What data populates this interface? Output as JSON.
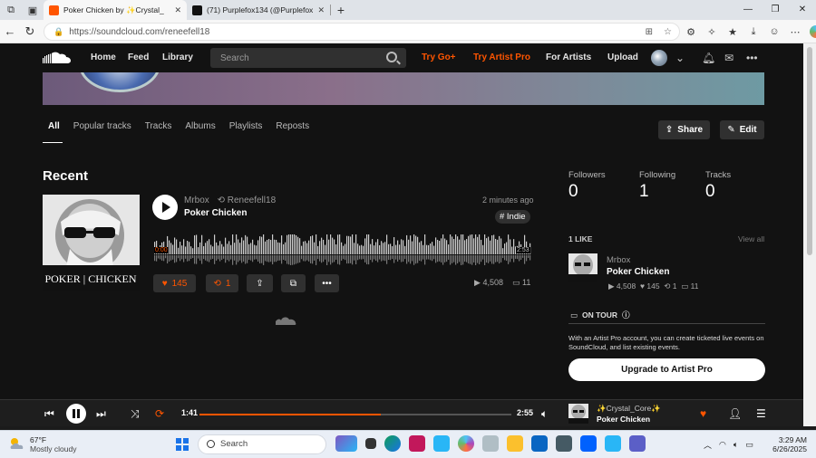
{
  "browser": {
    "tabs": [
      {
        "title": "Poker Chicken by ✨Crystal_",
        "active": true,
        "favicon_color": "#ff5500"
      },
      {
        "title": "(71) Purplefox134 (@Purplefox13",
        "active": false,
        "favicon_color": "#111111"
      }
    ],
    "url": "https://soundcloud.com/reneefell18"
  },
  "header": {
    "nav": [
      "Home",
      "Feed",
      "Library"
    ],
    "search_placeholder": "Search",
    "try_go": "Try Go+",
    "try_artist_pro": "Try Artist Pro",
    "for_artists": "For Artists",
    "upload": "Upload"
  },
  "profile_tabs": [
    "All",
    "Popular tracks",
    "Tracks",
    "Albums",
    "Playlists",
    "Reposts"
  ],
  "actions": {
    "share": "Share",
    "edit": "Edit"
  },
  "recent": {
    "title": "Recent",
    "track": {
      "user": "Mrbox",
      "reposter": "Reneefell18",
      "name": "Poker Chicken",
      "time": "2 minutes ago",
      "tag": "# Indie",
      "elapsed": "0:00",
      "duration": "2:53",
      "likes": "145",
      "reposts": "1",
      "plays": "4,508",
      "comments": "11",
      "artwork_text": "POKER | CHICKEN"
    }
  },
  "sidebar": {
    "stats": [
      {
        "label": "Followers",
        "value": "0"
      },
      {
        "label": "Following",
        "value": "1"
      },
      {
        "label": "Tracks",
        "value": "0"
      }
    ],
    "likes_header": "1 LIKE",
    "view_all": "View all",
    "like": {
      "user": "Mrbox",
      "name": "Poker Chicken",
      "plays": "4,508",
      "likes": "145",
      "reposts": "1",
      "comments": "11"
    },
    "tour_header": "ON TOUR",
    "tour_text": "With an Artist Pro account, you can create ticketed live events on SoundCloud, and list existing events.",
    "upgrade": "Upgrade to Artist Pro"
  },
  "player": {
    "elapsed": "1:41",
    "duration": "2:55",
    "progress": 0.58,
    "user": "✨Crystal_Core✨",
    "title": "Poker Chicken"
  },
  "taskbar": {
    "temp": "67°F",
    "weather": "Mostly cloudy",
    "search": "Search",
    "time": "3:29 AM",
    "date": "6/26/2025"
  },
  "colors": {
    "accent": "#ff5500",
    "bg": "#121212",
    "button": "#303030"
  }
}
